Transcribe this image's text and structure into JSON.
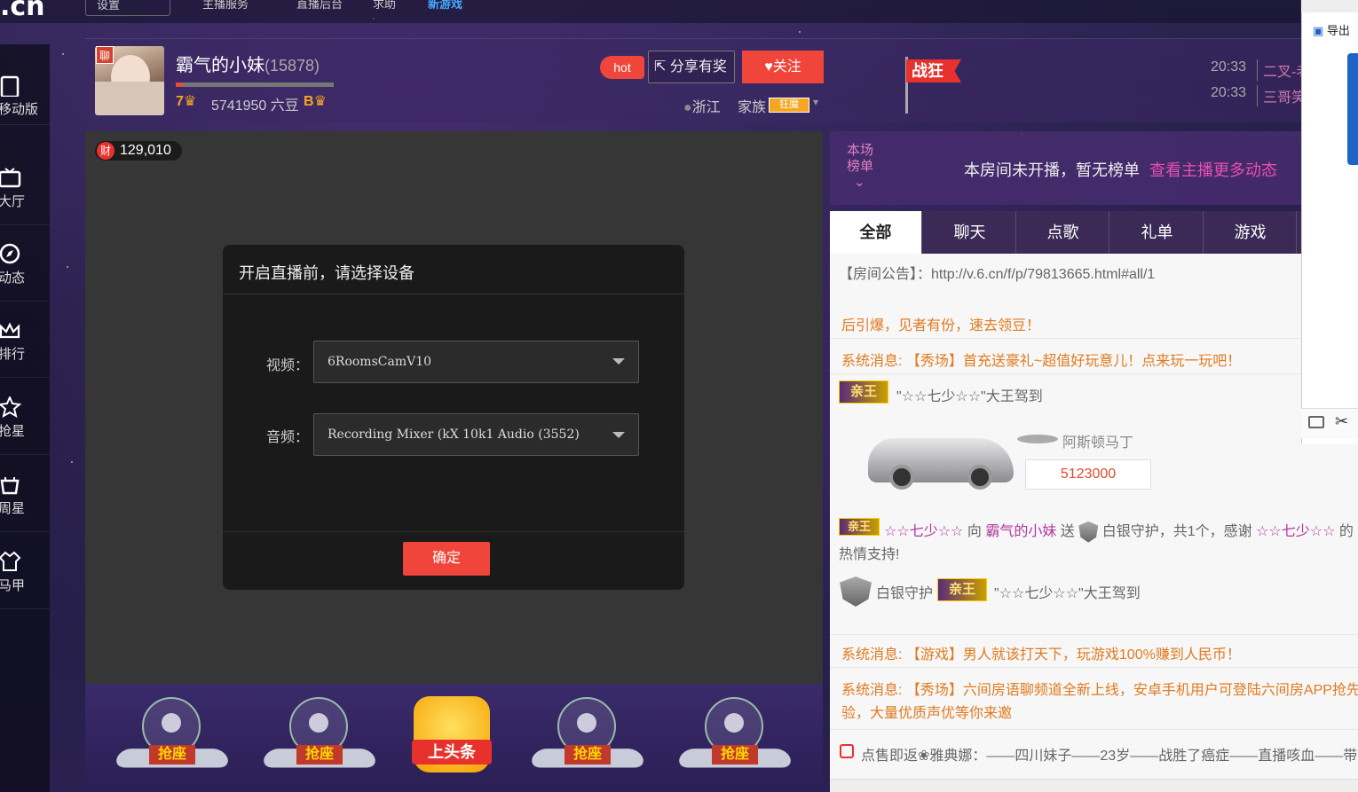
{
  "top": {
    "logo": ".cn",
    "buttons": [
      "设置",
      "主播服务",
      "直播后台",
      "求助",
      "新游戏"
    ]
  },
  "leftnav": [
    {
      "label": "移动版",
      "icon": "phone-icon"
    },
    {
      "label": "大厅",
      "icon": "tv-icon"
    },
    {
      "label": "动态",
      "icon": "compass-icon"
    },
    {
      "label": "排行",
      "icon": "crown-icon"
    },
    {
      "label": "抢星",
      "icon": "star-icon"
    },
    {
      "label": "周星",
      "icon": "cup-icon"
    },
    {
      "label": "马甲",
      "icon": "vest-icon"
    }
  ],
  "anchor": {
    "name": "霸气的小妹",
    "room_id": "(15878)",
    "level_left": "7",
    "beans": "5741950 六豆",
    "level_right": "B",
    "hot": "hot",
    "share": "分享有奖",
    "follow": "关注",
    "location": "浙江",
    "family_label": "家族",
    "family_tag": "狂魔",
    "flag": "战狂",
    "badge": "聊"
  },
  "ticker": [
    {
      "time": "20:33",
      "text": "二叉-老"
    },
    {
      "time": "20:33",
      "text": "三哥笑"
    }
  ],
  "video": {
    "wealth_icon": "财",
    "wealth": "129,010"
  },
  "dialog": {
    "title": "开启直播前，请选择设备",
    "video_label": "视频：",
    "video_value": "6RoomsCamV10",
    "audio_label": "音频：",
    "audio_value": "Recording Mixer (kX 10k1 Audio (3552)",
    "confirm": "确定"
  },
  "seats": [
    "抢座",
    "抢座",
    "上头条",
    "抢座",
    "抢座"
  ],
  "rank": {
    "label": "本场榜单",
    "text": "本房间未开播，暂无榜单",
    "link": "查看主播更多动态"
  },
  "tabs": [
    "全部",
    "聊天",
    "点歌",
    "礼单",
    "游戏"
  ],
  "chat": {
    "notice": "【房间公告】：http://v.6.cn/f/p/79813665.html#all/1",
    "line1": "后引爆，见者有份，速去领豆！",
    "sys_label": "系统消息:",
    "sys1": "【秀场】首充送豪礼~超值好玩意儿！点来玩一玩吧！",
    "king_badge": "亲王",
    "arrival1": "\"☆☆七少☆☆\"大王驾到",
    "car_name": "阿斯顿马丁",
    "car_price": "5123000",
    "gift_user": "☆☆七少☆☆",
    "gift_to": "向",
    "gift_target": "霸气的小妹",
    "gift_send": "送",
    "gift_item": "白银守护，共1个，感谢",
    "gift_thanks_user": "☆☆七少☆☆",
    "gift_tail": "的",
    "support": "热情支持!",
    "guard": "白银守护",
    "arrival2": "\"☆☆七少☆☆\"大王驾到",
    "sys2": "【游戏】男人就该打天下，玩游戏100%赚到人民币！",
    "sys3": "【秀场】六间房语聊频道全新上线，安卓手机用户可登陆六间房APP抢先",
    "sys3b": "验，大量优质声优等你来邀",
    "song": "点售即返❀雅典娜：——四川妹子——23岁——战胜了癌症——直播咳血——带"
  },
  "widget": {
    "export": "导出"
  }
}
